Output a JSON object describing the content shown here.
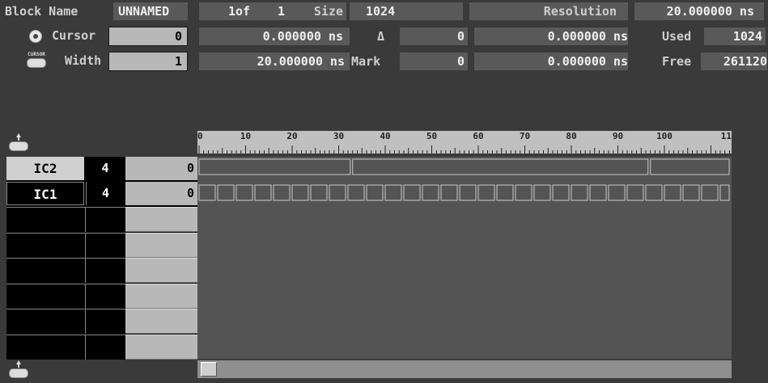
{
  "header": {
    "block_name_label": "Block Name",
    "block_name_value": "UNNAMED",
    "page_current": "1of",
    "page_total": "1",
    "size_label": "Size",
    "size_value": "1024",
    "resolution_label": "Resolution",
    "resolution_value": "20.000000 ns"
  },
  "cursor_row": {
    "label": "Cursor",
    "value": "0",
    "time": "0.000000 ns",
    "delta_symbol": "Δ",
    "delta_value": "0",
    "delta_time": "0.000000 ns",
    "used_label": "Used",
    "used_value": "1024"
  },
  "width_row": {
    "icon_text": "CURSOR",
    "label": "Width",
    "value": "1",
    "time": "20.000000 ns",
    "mark_label": "Mark",
    "mark_value": "0",
    "mark_time": "0.000000 ns",
    "free_label": "Free",
    "free_value": "261120"
  },
  "ruler": {
    "ticks": [
      "0",
      "10",
      "20",
      "30",
      "40",
      "50",
      "60",
      "70",
      "80",
      "90",
      "100",
      "11"
    ]
  },
  "signals": [
    {
      "name": "IC2",
      "bits": "4",
      "value": "0"
    },
    {
      "name": "IC1",
      "bits": "4",
      "value": "0"
    }
  ],
  "colors": {
    "background": "#3a3a3a",
    "field": "#595959",
    "waveform": "#545454",
    "input": "#b8b8b8"
  }
}
